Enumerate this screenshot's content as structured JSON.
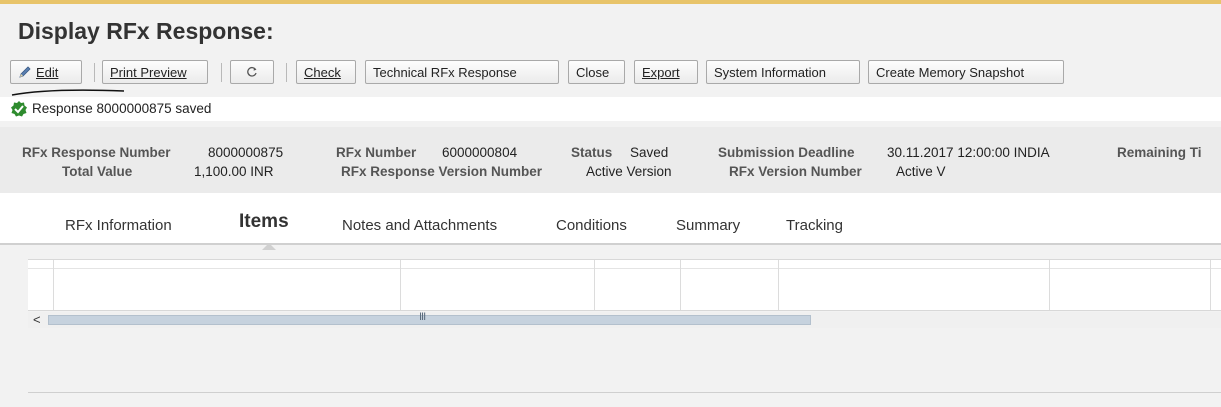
{
  "page": {
    "title": "Display RFx Response:"
  },
  "toolbar": {
    "edit_label": "Edit",
    "print_preview_label": "Print Preview",
    "refresh_icon": "refresh-icon",
    "check_label": "Check",
    "technical_rfx_response_label": "Technical RFx Response",
    "close_label": "Close",
    "export_label": "Export",
    "system_information_label": "System Information",
    "create_memory_snapshot_label": "Create Memory Snapshot"
  },
  "message": {
    "icon": "success-check-icon",
    "text": "Response 8000000875 saved"
  },
  "header": {
    "rfx_response_number_label": "RFx Response Number",
    "rfx_response_number_value": "8000000875",
    "total_value_label": "Total Value",
    "total_value_value": "1,100.00 INR",
    "rfx_number_label": "RFx Number",
    "rfx_number_value": "6000000804",
    "status_label": "Status",
    "status_value": "Saved",
    "rfx_response_version_number_label": "RFx Response Version Number",
    "rfx_response_version_number_value": "Active Version",
    "submission_deadline_label": "Submission Deadline",
    "submission_deadline_value": "30.11.2017 12:00:00 INDIA",
    "rfx_version_number_label": "RFx Version Number",
    "rfx_version_number_value": "Active V",
    "remaining_time_label": "Remaining Ti"
  },
  "tabs": [
    {
      "label": "RFx Information",
      "active": false
    },
    {
      "label": "Items",
      "active": true
    },
    {
      "label": "Notes and Attachments",
      "active": false
    },
    {
      "label": "Conditions",
      "active": false
    },
    {
      "label": "Summary",
      "active": false
    },
    {
      "label": "Tracking",
      "active": false
    }
  ],
  "scrollbar": {
    "left_arrow": "<",
    "grip": "III"
  },
  "colors": {
    "accent_strip": "#e8c46a",
    "success": "#2e8b2e"
  }
}
